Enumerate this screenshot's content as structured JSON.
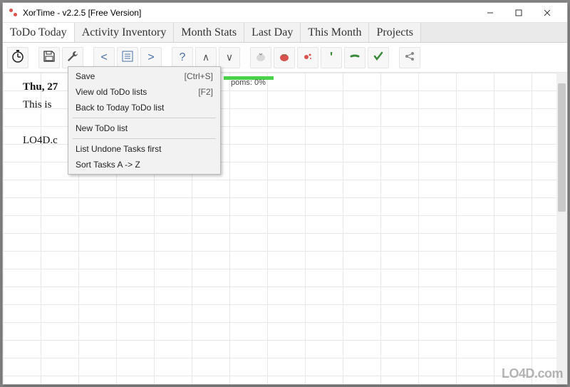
{
  "window": {
    "title": "XorTime - v2.2.5 [Free Version]"
  },
  "tabs": {
    "todo": "ToDo Today",
    "activity": "Activity Inventory",
    "month_stats": "Month Stats",
    "last_day": "Last Day",
    "this_month": "This Month",
    "projects": "Projects"
  },
  "menu": {
    "save": {
      "label": "Save",
      "shortcut": "[Ctrl+S]"
    },
    "view_old": {
      "label": "View old ToDo lists",
      "shortcut": "[F2]"
    },
    "back_today": {
      "label": "Back to Today ToDo list"
    },
    "new_list": {
      "label": "New ToDo list"
    },
    "undone_first": {
      "label": "List Undone Tasks first"
    },
    "sort_az": {
      "label": "Sort Tasks A -> Z"
    }
  },
  "content": {
    "date": "Thu, 27",
    "task1": "This is",
    "task2": "LO4D.c",
    "stats": "poms: 0%"
  },
  "watermark": "LO4D.com"
}
